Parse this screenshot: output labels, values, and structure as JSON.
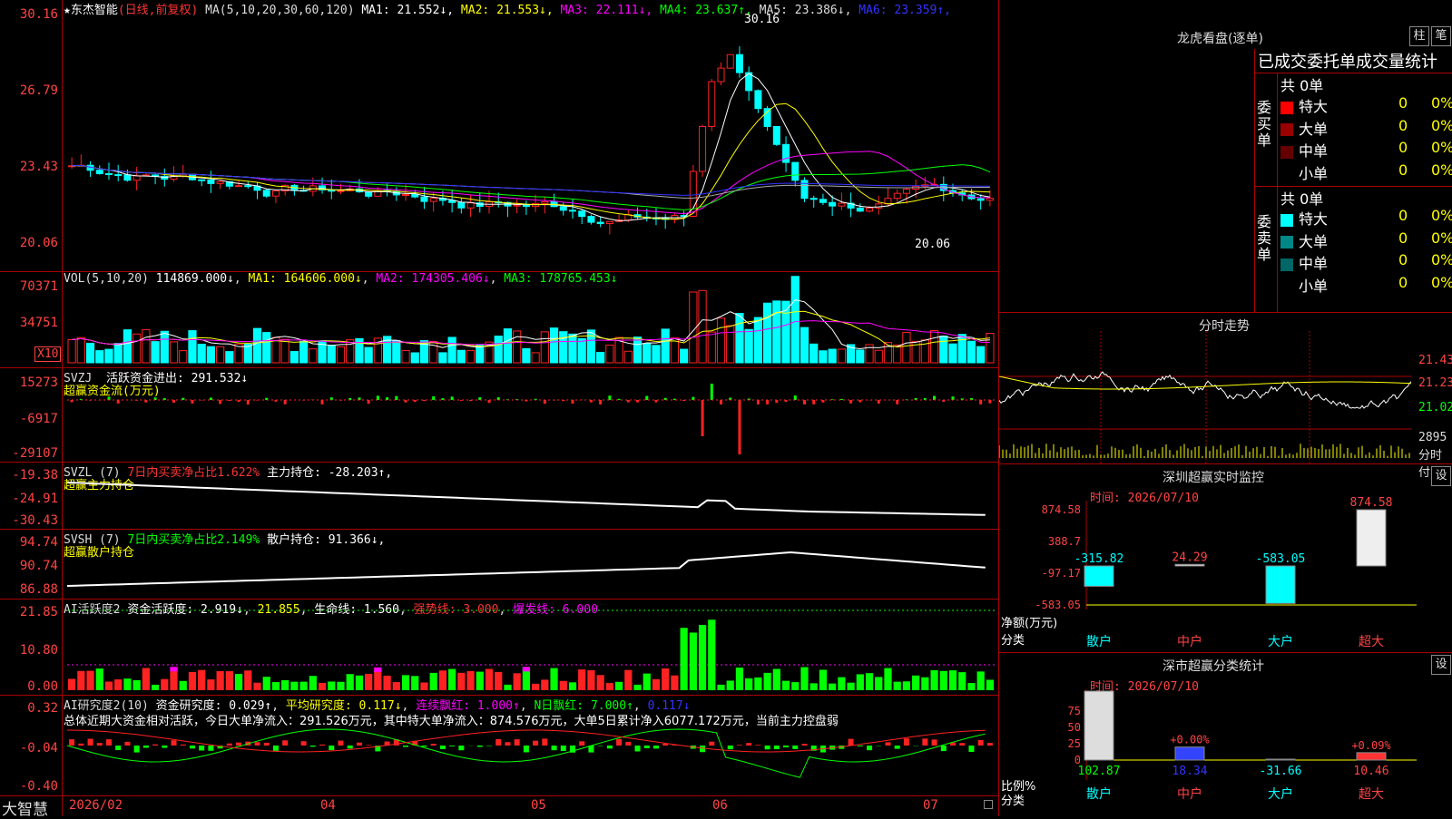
{
  "stock": {
    "name": "东杰智能",
    "mode": "(日线,前复权)",
    "star": "★"
  },
  "price_pane": {
    "ma_header": "MA(5,10,20,30,60,120)",
    "ma": [
      {
        "label": "MA1:",
        "value": "21.552↓",
        "color": "#ffffff"
      },
      {
        "label": "MA2:",
        "value": "21.553↓",
        "color": "#ffff00"
      },
      {
        "label": "MA3:",
        "value": "22.111↓",
        "color": "#ff00ff"
      },
      {
        "label": "MA4:",
        "value": "23.637↑",
        "color": "#00ff00"
      },
      {
        "label": "MA5:",
        "value": "23.386↓",
        "color": "#dddddd"
      },
      {
        "label": "MA6:",
        "value": "23.359↑",
        "color": "#3333ff"
      }
    ],
    "axis": [
      "30.16",
      "26.79",
      "23.43",
      "20.06"
    ],
    "high_label": "30.16",
    "low_label": "20.06"
  },
  "vol_pane": {
    "header": "VOL(5,10,20)",
    "vol": "114869.000↓",
    "ma1": "MA1: 164606.000↓",
    "ma2": "MA2: 174305.406↓",
    "ma3": "MA3: 178765.453↓",
    "axis": [
      "70371",
      "34751"
    ],
    "unit": "X10"
  },
  "svzj_pane": {
    "header": "SVZJ",
    "title": "活跃资金进出: 291.532↓",
    "sub": "超赢资金流(万元)",
    "axis": [
      "15273",
      "-6917",
      "-29107"
    ]
  },
  "svzl_pane": {
    "header": "SVZL (7)",
    "ratio": "7日内买卖净占比1.622%",
    "hold": "主力持仓: -28.203↑,",
    "sub": "超赢主力持仓",
    "axis": [
      "-19.38",
      "-24.91",
      "-30.43"
    ]
  },
  "svsh_pane": {
    "header": "SVSH (7)",
    "ratio": "7日内买卖净占比2.149%",
    "hold": "散户持仓: 91.366↓,",
    "sub": "超赢散户持仓",
    "axis": [
      "94.74",
      "90.74",
      "86.88"
    ]
  },
  "ai_pane": {
    "header": "AI活跃度2",
    "t1": "资金活跃度: 2.919↓",
    "t2": "21.855",
    "t3": "生命线: 1.560",
    "t4": "强势线: 3.000",
    "t5": "爆发线: 6.000",
    "axis": [
      "21.85",
      "10.80",
      "0.00"
    ]
  },
  "ai2_pane": {
    "header": "AI研究度2(10)",
    "t1": "资金研究度: 0.029↑",
    "t2": "平均研究度: 0.117↓",
    "t3": "连续飘红: 1.000↑",
    "t4": "N日飘红: 7.000↑",
    "t5": "0.117↓",
    "summary": "总体近期大资金相对活跃，今日大单净流入：291.526万元，其中特大单净流入：874.576万元，大单5日累计净入6077.172万元，当前主力控盘弱",
    "axis": [
      "0.32",
      "-0.04",
      "-0.40"
    ]
  },
  "date_axis": {
    "brand": "大智慧",
    "labels": [
      "2026/02",
      "04",
      "05",
      "06",
      "07"
    ]
  },
  "lhb": {
    "title": "龙虎看盘(逐单)",
    "btn1": "柱",
    "btn2": "笔",
    "subtitle": "已成交委托单成交量统计",
    "buy_label": "委买单",
    "sell_label": "委卖单",
    "buy_total": "共 0单",
    "sell_total": "共 0单",
    "buy_rows": [
      {
        "name": "特大",
        "v": "0",
        "p": "0%",
        "c": "#ff0000"
      },
      {
        "name": "大单",
        "v": "0",
        "p": "0%",
        "c": "#990000"
      },
      {
        "name": "中单",
        "v": "0",
        "p": "0%",
        "c": "#660000"
      },
      {
        "name": "小单",
        "v": "0",
        "p": "0%",
        "c": "#000000"
      }
    ],
    "sell_rows": [
      {
        "name": "特大",
        "v": "0",
        "p": "0%",
        "c": "#00ffff"
      },
      {
        "name": "大单",
        "v": "0",
        "p": "0%",
        "c": "#008888"
      },
      {
        "name": "中单",
        "v": "0",
        "p": "0%",
        "c": "#006666"
      },
      {
        "name": "小单",
        "v": "0",
        "p": "0%",
        "c": "#000000"
      }
    ]
  },
  "intraday": {
    "title": "分时走势",
    "axis": [
      "21.43",
      "21.23",
      "21.02"
    ],
    "vol_label": "2895",
    "unit": "分时付"
  },
  "sz_monitor": {
    "title": "深圳超赢实时监控",
    "btn": "设",
    "time": "时间: 2026/07/10",
    "axis": [
      "874.58",
      "388.7",
      "-97.17",
      "-583.05"
    ],
    "bars": [
      {
        "label": "散户",
        "value": "-315.82"
      },
      {
        "label": "中户",
        "value": "24.29"
      },
      {
        "label": "大户",
        "value": "-583.05"
      },
      {
        "label": "超大",
        "value": "874.58"
      }
    ],
    "ylabel": "净额(万元)",
    "xlabel": "分类"
  },
  "sz_stats": {
    "title": "深市超赢分类统计",
    "btn": "设",
    "time": "时间: 2026/07/10",
    "axis": [
      "75",
      "50",
      "25",
      "0"
    ],
    "bars": [
      {
        "label": "散户",
        "value": "102.87",
        "pct": ""
      },
      {
        "label": "中户",
        "value": "18.34",
        "pct": "+0.00%"
      },
      {
        "label": "大户",
        "value": "-31.66",
        "pct": ""
      },
      {
        "label": "超大",
        "value": "10.46",
        "pct": "+0.09%"
      }
    ],
    "ylabel": "比例%",
    "xlabel": "分类"
  }
}
